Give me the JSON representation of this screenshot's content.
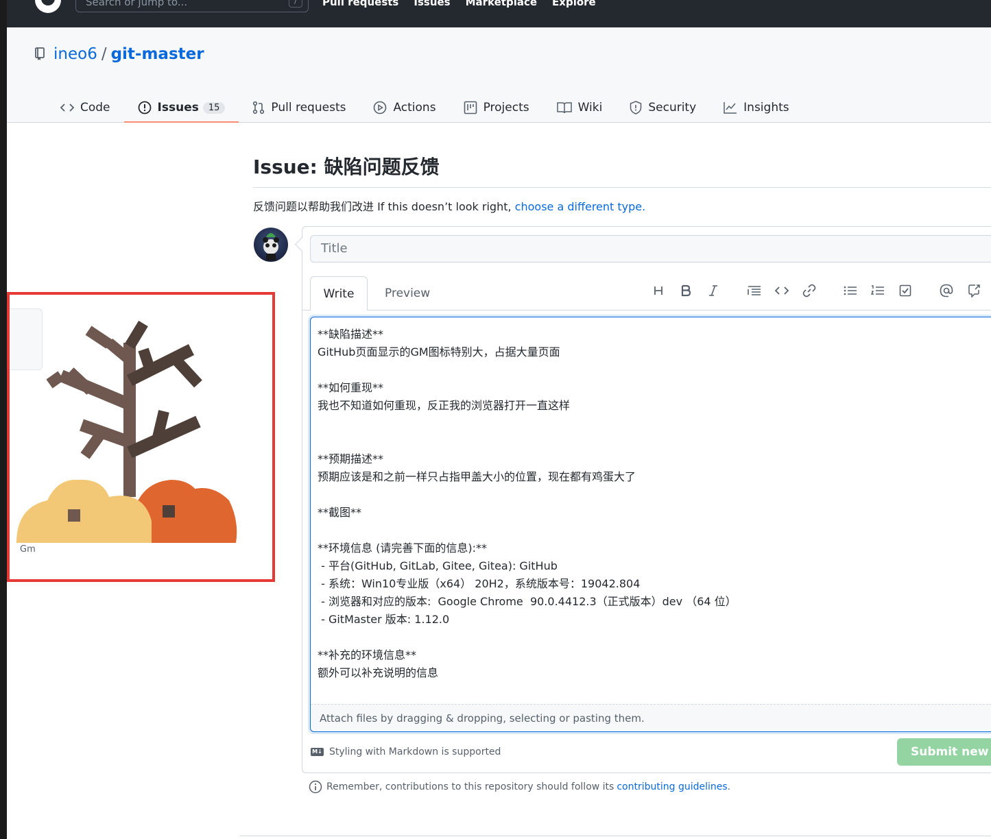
{
  "header": {
    "search_placeholder": "Search or jump to...",
    "search_shortcut": "/",
    "nav": [
      "Pull requests",
      "Issues",
      "Marketplace",
      "Explore"
    ]
  },
  "repo": {
    "owner": "ineo6",
    "separator": "/",
    "name": "git-master"
  },
  "tabs": [
    {
      "label": "Code",
      "icon": "code-icon"
    },
    {
      "label": "Issues",
      "icon": "issue-opened-icon",
      "count": "15",
      "selected": true
    },
    {
      "label": "Pull requests",
      "icon": "git-pull-request-icon"
    },
    {
      "label": "Actions",
      "icon": "play-icon"
    },
    {
      "label": "Projects",
      "icon": "project-icon"
    },
    {
      "label": "Wiki",
      "icon": "book-icon"
    },
    {
      "label": "Security",
      "icon": "shield-icon"
    },
    {
      "label": "Insights",
      "icon": "graph-icon"
    }
  ],
  "issue": {
    "title": "Issue: 缺陷问题反馈",
    "subtitle_text": "反馈问题以帮助我们改进 If this doesn’t look right, ",
    "subtitle_link": "choose a different type."
  },
  "form": {
    "title_placeholder": "Title",
    "write_tab": "Write",
    "preview_tab": "Preview",
    "toolbar": [
      "heading-icon",
      "bold-icon",
      "italic-icon",
      "quote-icon",
      "code-icon",
      "link-icon",
      "unordered-list-icon",
      "ordered-list-icon",
      "task-list-icon",
      "mention-icon",
      "cross-reference-icon"
    ],
    "body": "**缺陷描述**\nGitHub页面显示的GM图标特别大，占据大量页面\n\n**如何重现**\n我也不知道如何重现，反正我的浏览器打开一直这样\n\n\n**预期描述**\n预期应该是和之前一样只占指甲盖大小的位置，现在都有鸡蛋大了\n\n**截图**\n\n**环境信息 (请完善下面的信息):**\n - 平台(GitHub, GitLab, Gitee, Gitea): GitHub\n - 系统：Win10专业版（x64） 20H2，系统版本号：19042.804\n - 浏览器和对应的版本:  Google Chrome  90.0.4412.3（正式版本）dev （64 位）\n - GitMaster 版本: 1.12.0\n\n**补充的环境信息**\n额外可以补充说明的信息",
    "attach_hint": "Attach files by dragging & dropping, selecting or pasting them.",
    "markdown_note": "Styling with Markdown is supported",
    "submit_label": "Submit new issue"
  },
  "footer_note": {
    "text": "Remember, contributions to this repository should follow its",
    "link": "contributing guidelines",
    "end": "."
  },
  "overlay": {
    "label": "Gm"
  }
}
